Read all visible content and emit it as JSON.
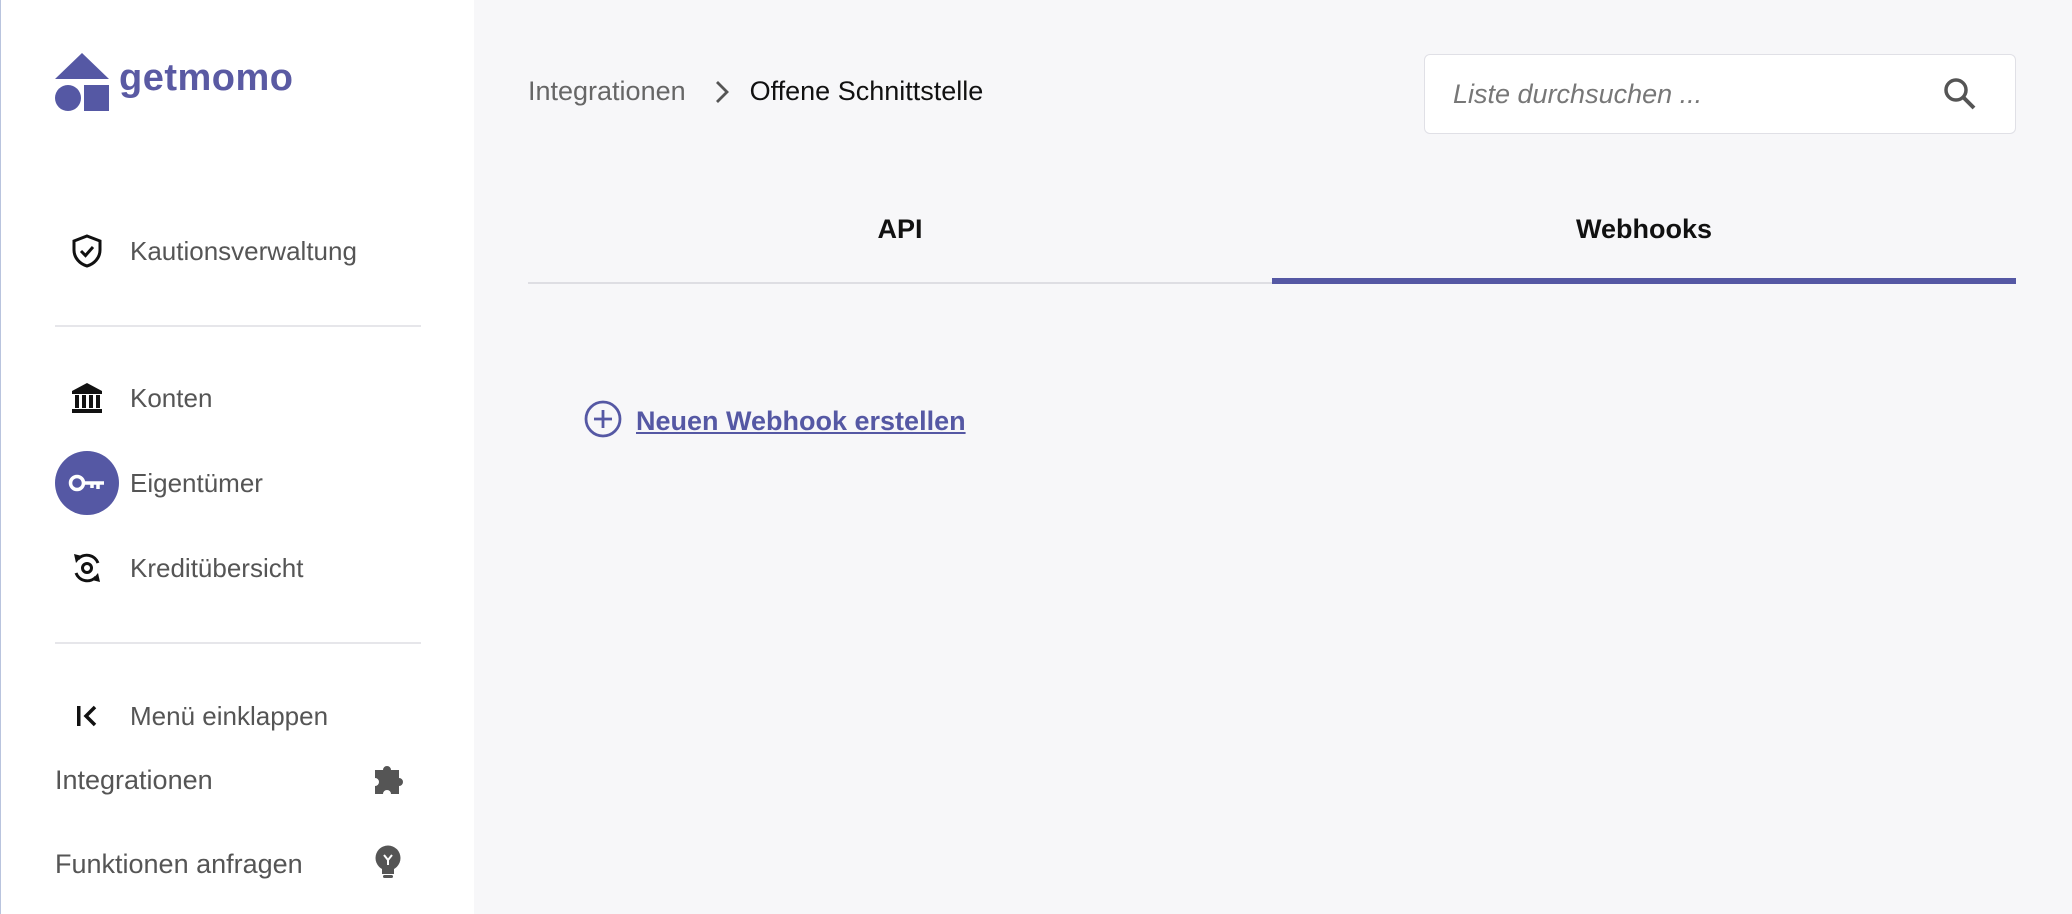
{
  "brand": {
    "name": "getmomo",
    "color": "#5558a4"
  },
  "sidebar": {
    "items": [
      {
        "label": "Kautionsverwaltung",
        "icon": "shield-check-icon",
        "active": false
      },
      {
        "label": "Konten",
        "icon": "bank-icon",
        "active": false
      },
      {
        "label": "Eigentümer",
        "icon": "key-icon",
        "active": true
      },
      {
        "label": "Kreditübersicht",
        "icon": "refresh-credit-icon",
        "active": false
      },
      {
        "label": "Menü einklappen",
        "icon": "collapse-menu-icon",
        "active": false
      }
    ],
    "footer": [
      {
        "label": "Integrationen",
        "icon": "puzzle-icon"
      },
      {
        "label": "Funktionen anfragen",
        "icon": "lightbulb-icon"
      }
    ]
  },
  "breadcrumb": {
    "parent": "Integrationen",
    "current": "Offene Schnittstelle"
  },
  "search": {
    "placeholder": "Liste durchsuchen ...",
    "value": ""
  },
  "tabs": [
    {
      "label": "API",
      "active": false
    },
    {
      "label": "Webhooks",
      "active": true
    }
  ],
  "actions": {
    "create_webhook": "Neuen Webhook erstellen"
  }
}
